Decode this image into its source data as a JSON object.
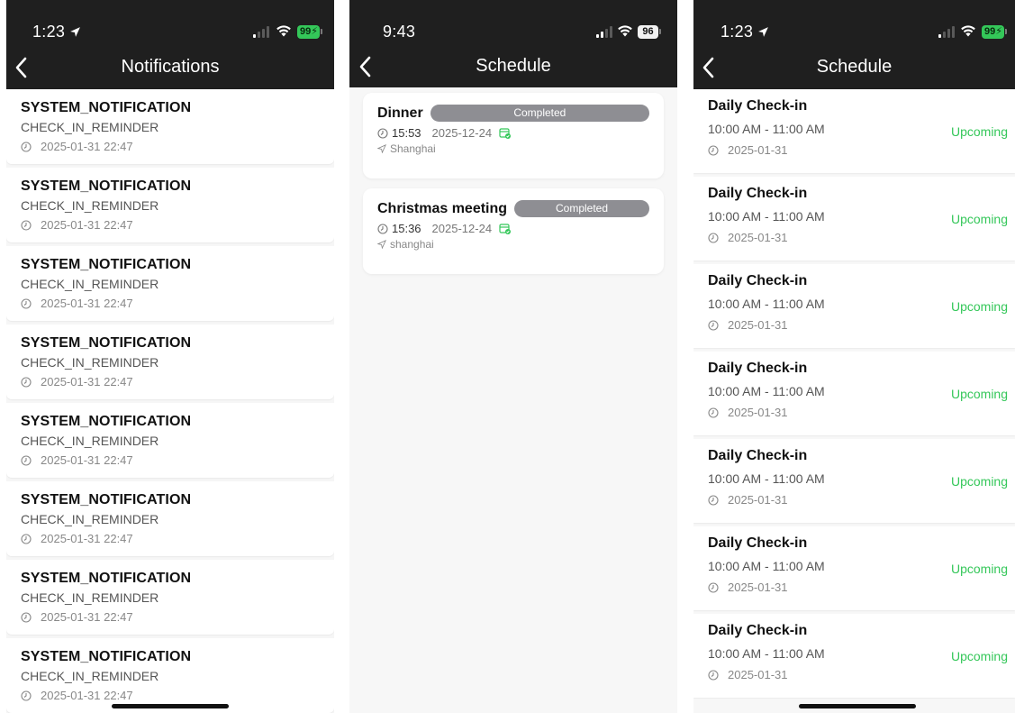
{
  "screens": {
    "notifications": {
      "status": {
        "time": "1:23",
        "battery": "99"
      },
      "title": "Notifications",
      "items": [
        {
          "title": "SYSTEM_NOTIFICATION",
          "subtitle": "CHECK_IN_REMINDER",
          "datetime": "2025-01-31 22:47"
        },
        {
          "title": "SYSTEM_NOTIFICATION",
          "subtitle": "CHECK_IN_REMINDER",
          "datetime": "2025-01-31 22:47"
        },
        {
          "title": "SYSTEM_NOTIFICATION",
          "subtitle": "CHECK_IN_REMINDER",
          "datetime": "2025-01-31 22:47"
        },
        {
          "title": "SYSTEM_NOTIFICATION",
          "subtitle": "CHECK_IN_REMINDER",
          "datetime": "2025-01-31 22:47"
        },
        {
          "title": "SYSTEM_NOTIFICATION",
          "subtitle": "CHECK_IN_REMINDER",
          "datetime": "2025-01-31 22:47"
        },
        {
          "title": "SYSTEM_NOTIFICATION",
          "subtitle": "CHECK_IN_REMINDER",
          "datetime": "2025-01-31 22:47"
        },
        {
          "title": "SYSTEM_NOTIFICATION",
          "subtitle": "CHECK_IN_REMINDER",
          "datetime": "2025-01-31 22:47"
        },
        {
          "title": "SYSTEM_NOTIFICATION",
          "subtitle": "CHECK_IN_REMINDER",
          "datetime": "2025-01-31 22:47"
        }
      ]
    },
    "schedule_cards": {
      "status": {
        "time": "9:43",
        "battery": "96"
      },
      "title": "Schedule",
      "cards": [
        {
          "name": "Dinner",
          "status": "Completed",
          "time": "15:53",
          "date": "2025-12-24",
          "location": "Shanghai"
        },
        {
          "name": "Christmas meeting",
          "status": "Completed",
          "time": "15:36",
          "date": "2025-12-24",
          "location": "shanghai"
        }
      ]
    },
    "schedule_list": {
      "status": {
        "time": "1:23",
        "battery": "99"
      },
      "title": "Schedule",
      "items": [
        {
          "title": "Daily Check-in",
          "range": "10:00 AM - 11:00 AM",
          "date": "2025-01-31",
          "status": "Upcoming"
        },
        {
          "title": "Daily Check-in",
          "range": "10:00 AM - 11:00 AM",
          "date": "2025-01-31",
          "status": "Upcoming"
        },
        {
          "title": "Daily Check-in",
          "range": "10:00 AM - 11:00 AM",
          "date": "2025-01-31",
          "status": "Upcoming"
        },
        {
          "title": "Daily Check-in",
          "range": "10:00 AM - 11:00 AM",
          "date": "2025-01-31",
          "status": "Upcoming"
        },
        {
          "title": "Daily Check-in",
          "range": "10:00 AM - 11:00 AM",
          "date": "2025-01-31",
          "status": "Upcoming"
        },
        {
          "title": "Daily Check-in",
          "range": "10:00 AM - 11:00 AM",
          "date": "2025-01-31",
          "status": "Upcoming"
        },
        {
          "title": "Daily Check-in",
          "range": "10:00 AM - 11:00 AM",
          "date": "2025-01-31",
          "status": "Upcoming"
        }
      ]
    }
  },
  "colors": {
    "header_bg": "#1f1f1f",
    "upcoming": "#34c759",
    "completed_pill": "#8e8e93",
    "battery_green": "#34c759"
  },
  "icons": [
    "back-chevron-icon",
    "location-arrow-icon",
    "signal-icon",
    "wifi-icon",
    "battery-icon",
    "clock-icon",
    "calendar-check-icon",
    "location-pin-icon"
  ]
}
